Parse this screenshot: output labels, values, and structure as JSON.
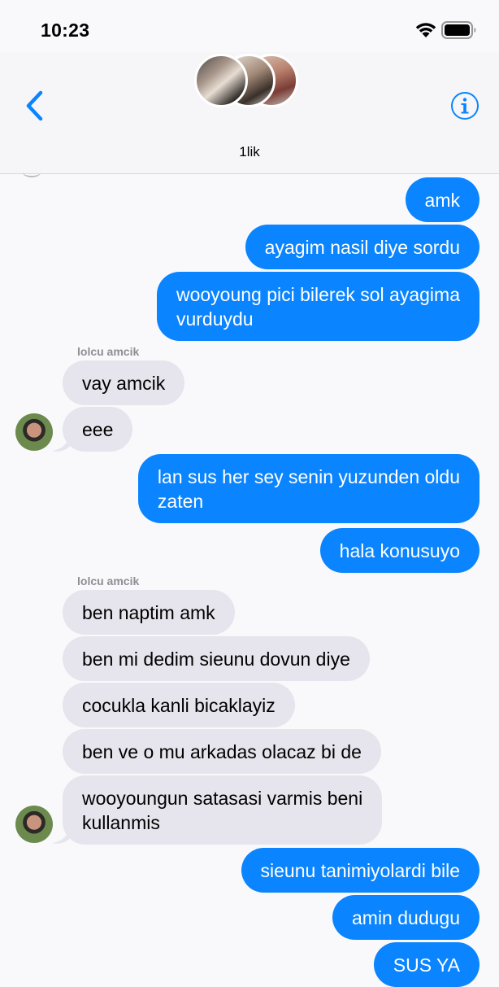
{
  "status_bar": {
    "time": "10:23",
    "wifi_icon": "wifi-icon",
    "battery_icon": "battery-icon"
  },
  "header": {
    "group_name": "1lik",
    "back_icon": "chevron-left-icon",
    "info_icon": "info-icon",
    "accent_color": "#0a84ff"
  },
  "messages": [
    {
      "direction": "out",
      "text": "amk"
    },
    {
      "direction": "out",
      "text": "ayagim nasil diye sordu"
    },
    {
      "direction": "out",
      "text": "wooyoung pici bilerek sol ayagima\nvurduydu"
    },
    {
      "direction": "in",
      "sender": "lolcu amcik",
      "text": "vay amcik"
    },
    {
      "direction": "in",
      "text": "eee"
    },
    {
      "direction": "out",
      "text": "lan sus her sey senin yuzunden oldu\nzaten"
    },
    {
      "direction": "out",
      "text": "hala konusuyo"
    },
    {
      "direction": "in",
      "sender": "lolcu amcik",
      "text": "ben naptim amk"
    },
    {
      "direction": "in",
      "text": "ben mi dedim sieunu dovun diye"
    },
    {
      "direction": "in",
      "text": "cocukla kanli bicaklayiz"
    },
    {
      "direction": "in",
      "text": "ben ve o mu arkadas olacaz bi de"
    },
    {
      "direction": "in",
      "text": "wooyoungun satasasi varmis beni\nkullanmis"
    },
    {
      "direction": "out",
      "text": "sieunu tanimiyolardi bile"
    },
    {
      "direction": "out",
      "text": "amin dudugu"
    },
    {
      "direction": "out",
      "text": "SUS YA"
    }
  ],
  "colors": {
    "outgoing_bubble": "#0a84ff",
    "incoming_bubble": "#e6e4ec",
    "background": "#f9f9fb"
  }
}
